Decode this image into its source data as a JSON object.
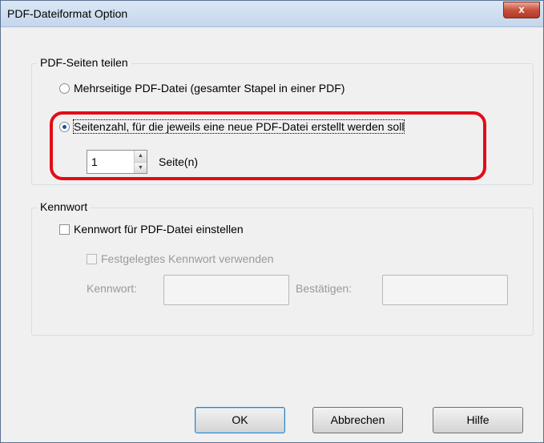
{
  "window": {
    "title": "PDF-Dateiformat Option",
    "close_label": "x"
  },
  "split_group": {
    "legend": "PDF-Seiten teilen",
    "option_multi": "Mehrseitige PDF-Datei (gesamter Stapel in einer PDF)",
    "option_pages": "Seitenzahl, für die jeweils eine neue PDF-Datei erstellt werden soll",
    "selected": "option_pages",
    "page_count": "1",
    "page_unit": "Seite(n)",
    "spin_up": "▲",
    "spin_down": "▼"
  },
  "password_group": {
    "legend": "Kennwort",
    "set_password_label": "Kennwort für PDF-Datei einstellen",
    "use_fixed_label": "Festgelegtes Kennwort verwenden",
    "password_label": "Kennwort:",
    "confirm_label": "Bestätigen:",
    "password_value": "",
    "confirm_value": ""
  },
  "buttons": {
    "ok": "OK",
    "cancel": "Abbrechen",
    "help": "Hilfe"
  },
  "colors": {
    "highlight": "#e30c17",
    "selected_radio": "#1c4fa0"
  }
}
